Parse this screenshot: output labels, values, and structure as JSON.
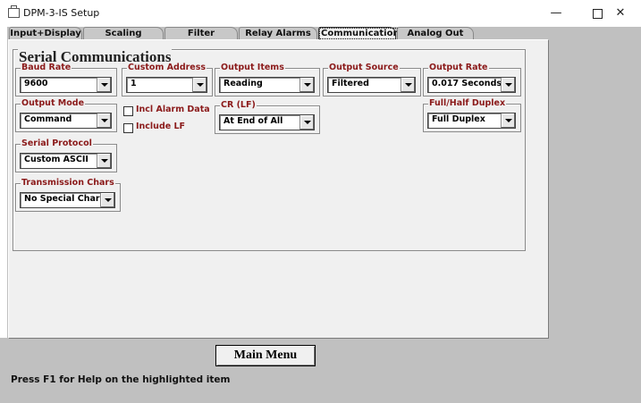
{
  "window": {
    "title": "DPM-3-IS Setup",
    "minimize": "—",
    "close": "✕"
  },
  "tabs": [
    {
      "label": "Input+Display",
      "active": false
    },
    {
      "label": "Scaling",
      "active": false
    },
    {
      "label": "Filter",
      "active": false
    },
    {
      "label": "Relay Alarms",
      "active": false
    },
    {
      "label": "Communication",
      "active": true
    },
    {
      "label": "Analog Out",
      "active": false
    }
  ],
  "section": {
    "title": "Serial Communications"
  },
  "fields": {
    "baud_rate": {
      "label": "Baud Rate",
      "value": "9600"
    },
    "custom_address": {
      "label": "Custom Address",
      "value": "1"
    },
    "output_items": {
      "label": "Output Items",
      "value": "Reading"
    },
    "output_source": {
      "label": "Output Source",
      "value": "Filtered"
    },
    "output_rate": {
      "label": "Output Rate",
      "value": "0.017 Seconds"
    },
    "output_mode": {
      "label": "Output Mode",
      "value": "Command"
    },
    "cr_lf": {
      "label": "CR (LF)",
      "value": "At End of All"
    },
    "duplex": {
      "label": "Full/Half Duplex",
      "value": "Full Duplex"
    },
    "serial_protocol": {
      "label": "Serial Protocol",
      "value": "Custom ASCII"
    },
    "transmission_chars": {
      "label": "Transmission Chars",
      "value": "No Special Char"
    }
  },
  "checkboxes": {
    "incl_alarm_data": {
      "label": "Incl Alarm Data",
      "checked": false
    },
    "include_lf": {
      "label": "Include LF",
      "checked": false
    }
  },
  "footer": {
    "main_menu_label": "Main Menu",
    "help_text": "Press F1 for Help on the highlighted item"
  }
}
